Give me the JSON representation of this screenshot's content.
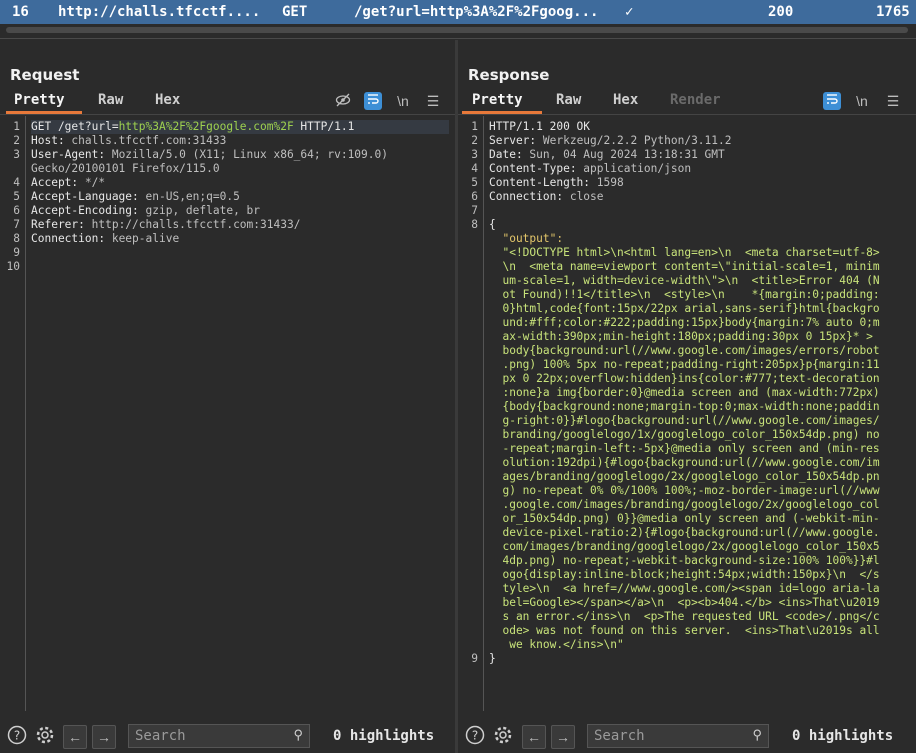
{
  "history_row": {
    "num": "16",
    "host": "http://challs.tfcctf....",
    "method": "GET",
    "path": "/get?url=http%3A%2F%2Fgoog...",
    "edited": "✓",
    "status": "200",
    "length": "1765"
  },
  "request": {
    "title": "Request",
    "tabs": [
      "Pretty",
      "Raw",
      "Hex"
    ],
    "line_numbers": [
      "1",
      "2",
      "3",
      "",
      "4",
      "5",
      "6",
      "7",
      "8",
      "9",
      "10"
    ],
    "lines": [
      {
        "a": "GET /get?url=",
        "b": "http%3A%2F%2Fgoogle.com%2F",
        "c": " HTTP/1.1"
      },
      {
        "a": "Host: ",
        "b": "challs.tfcctf.com:31433"
      },
      {
        "a": "User-Agent: ",
        "b": "Mozilla/5.0 (X11; Linux x86_64; rv:109.0)"
      },
      {
        "a": "",
        "b": "Gecko/20100101 Firefox/115.0"
      },
      {
        "a": "Accept: ",
        "b": "*/*"
      },
      {
        "a": "Accept-Language: ",
        "b": "en-US,en;q=0.5"
      },
      {
        "a": "Accept-Encoding: ",
        "b": "gzip, deflate, br"
      },
      {
        "a": "Referer: ",
        "b": "http://challs.tfcctf.com:31433/"
      },
      {
        "a": "Connection: ",
        "b": "keep-alive"
      },
      {
        "a": "",
        "b": ""
      },
      {
        "a": "",
        "b": ""
      }
    ],
    "footer": {
      "search_placeholder": "Search",
      "highlights": "0 highlights"
    }
  },
  "response": {
    "title": "Response",
    "tabs": [
      "Pretty",
      "Raw",
      "Hex",
      "Render"
    ],
    "line_numbers": [
      "1",
      "2",
      "3",
      "4",
      "5",
      "6",
      "7",
      "8",
      "",
      "",
      "",
      "",
      "",
      "",
      "",
      "",
      "",
      "",
      "",
      "",
      "",
      "",
      "",
      "",
      "",
      "",
      "",
      "",
      "",
      "",
      "",
      "",
      "",
      "",
      "",
      "",
      "",
      "",
      "9"
    ],
    "lines": [
      {
        "t": "h",
        "a": "HTTP/1.1 200 OK"
      },
      {
        "t": "h",
        "a": "Server: ",
        "b": "Werkzeug/2.2.2 Python/3.11.2"
      },
      {
        "t": "h",
        "a": "Date: ",
        "b": "Sun, 04 Aug 2024 13:18:31 GMT"
      },
      {
        "t": "h",
        "a": "Content-Type: ",
        "b": "application/json"
      },
      {
        "t": "h",
        "a": "Content-Length: ",
        "b": "1598"
      },
      {
        "t": "h",
        "a": "Connection: ",
        "b": "close"
      },
      {
        "t": "h",
        "a": ""
      },
      {
        "t": "h",
        "a": "{"
      },
      {
        "t": "p",
        "a": "  \"output\":"
      },
      {
        "t": "s",
        "a": "  \"<!DOCTYPE html>\\n<html lang=en>\\n  <meta charset=utf-8>"
      },
      {
        "t": "s",
        "a": "  \\n  <meta name=viewport content=\\\"initial-scale=1, minim"
      },
      {
        "t": "s",
        "a": "  um-scale=1, width=device-width\\\">\\n  <title>Error 404 (N"
      },
      {
        "t": "s",
        "a": "  ot Found)!!1</title>\\n  <style>\\n    *{margin:0;padding:"
      },
      {
        "t": "s",
        "a": "  0}html,code{font:15px/22px arial,sans-serif}html{backgro"
      },
      {
        "t": "s",
        "a": "  und:#fff;color:#222;padding:15px}body{margin:7% auto 0;m"
      },
      {
        "t": "s",
        "a": "  ax-width:390px;min-height:180px;padding:30px 0 15px}* >"
      },
      {
        "t": "s",
        "a": "  body{background:url(//www.google.com/images/errors/robot"
      },
      {
        "t": "s",
        "a": "  .png) 100% 5px no-repeat;padding-right:205px}p{margin:11"
      },
      {
        "t": "s",
        "a": "  px 0 22px;overflow:hidden}ins{color:#777;text-decoration"
      },
      {
        "t": "s",
        "a": "  :none}a img{border:0}@media screen and (max-width:772px)"
      },
      {
        "t": "s",
        "a": "  {body{background:none;margin-top:0;max-width:none;paddin"
      },
      {
        "t": "s",
        "a": "  g-right:0}}#logo{background:url(//www.google.com/images/"
      },
      {
        "t": "s",
        "a": "  branding/googlelogo/1x/googlelogo_color_150x54dp.png) no"
      },
      {
        "t": "s",
        "a": "  -repeat;margin-left:-5px}@media only screen and (min-res"
      },
      {
        "t": "s",
        "a": "  olution:192dpi){#logo{background:url(//www.google.com/im"
      },
      {
        "t": "s",
        "a": "  ages/branding/googlelogo/2x/googlelogo_color_150x54dp.pn"
      },
      {
        "t": "s",
        "a": "  g) no-repeat 0% 0%/100% 100%;-moz-border-image:url(//www"
      },
      {
        "t": "s",
        "a": "  .google.com/images/branding/googlelogo/2x/googlelogo_col"
      },
      {
        "t": "s",
        "a": "  or_150x54dp.png) 0}}@media only screen and (-webkit-min-"
      },
      {
        "t": "s",
        "a": "  device-pixel-ratio:2){#logo{background:url(//www.google."
      },
      {
        "t": "s",
        "a": "  com/images/branding/googlelogo/2x/googlelogo_color_150x5"
      },
      {
        "t": "s",
        "a": "  4dp.png) no-repeat;-webkit-background-size:100% 100%}}#l"
      },
      {
        "t": "s",
        "a": "  ogo{display:inline-block;height:54px;width:150px}\\n  </s"
      },
      {
        "t": "s",
        "a": "  tyle>\\n  <a href=//www.google.com/><span id=logo aria-la"
      },
      {
        "t": "s",
        "a": "  bel=Google></span></a>\\n  <p><b>404.</b> <ins>That\\u2019"
      },
      {
        "t": "s",
        "a": "  s an error.</ins>\\n  <p>The requested URL <code>/.png</c"
      },
      {
        "t": "s",
        "a": "  ode> was not found on this server.  <ins>That\\u2019s all"
      },
      {
        "t": "s",
        "a": "   we know.</ins>\\n\""
      },
      {
        "t": "h",
        "a": "}"
      },
      {
        "t": "h",
        "a": ""
      }
    ],
    "footer": {
      "search_placeholder": "Search",
      "highlights": "0 highlights"
    }
  },
  "icons": {
    "hide": "eye-off-icon",
    "wrap": "word-wrap-icon",
    "newline": "\\n",
    "menu": "hamburger-menu-icon",
    "help": "help-icon",
    "settings": "gear-icon",
    "back": "arrow-left-icon",
    "forward": "arrow-right-icon",
    "search": "search-icon"
  },
  "colors": {
    "accent": "#e8793a",
    "selected_row": "#3e6b9c",
    "toggle_on": "#3d8fd6",
    "string": "#c8e37a",
    "url": "#9ed14f"
  }
}
